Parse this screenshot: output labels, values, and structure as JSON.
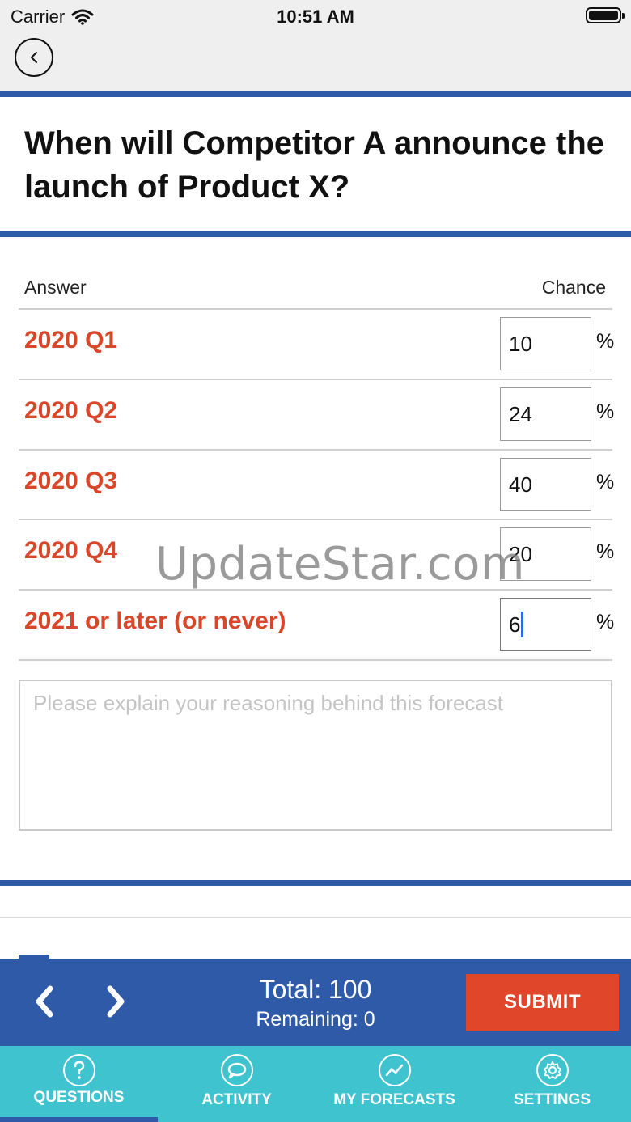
{
  "status_bar": {
    "carrier": "Carrier",
    "time": "10:51 AM"
  },
  "question": {
    "title": "When will Competitor A announce the launch of Product X?"
  },
  "table": {
    "answer_header": "Answer",
    "chance_header": "Chance",
    "rows": [
      {
        "label": "2020 Q1",
        "value": "10",
        "unit": "%"
      },
      {
        "label": "2020 Q2",
        "value": "24",
        "unit": "%"
      },
      {
        "label": "2020 Q3",
        "value": "40",
        "unit": "%"
      },
      {
        "label": "2020 Q4",
        "value": "20",
        "unit": "%"
      },
      {
        "label": "2021 or later (or never)",
        "value": "6",
        "unit": "%"
      }
    ]
  },
  "reasoning": {
    "placeholder": "Please explain your reasoning behind this forecast"
  },
  "watermark": "UpdateStar.com",
  "action_bar": {
    "total": "Total: 100",
    "remaining": "Remaining: 0",
    "submit_label": "SUBMIT"
  },
  "tabs": [
    {
      "label": "QUESTIONS",
      "icon": "question-icon",
      "active": true
    },
    {
      "label": "ACTIVITY",
      "icon": "chat-bubble-icon",
      "active": false
    },
    {
      "label": "MY FORECASTS",
      "icon": "trend-line-icon",
      "active": false
    },
    {
      "label": "SETTINGS",
      "icon": "gear-icon",
      "active": false
    }
  ],
  "colors": {
    "accent_blue": "#2f5aa8",
    "answer_red": "#d9472b",
    "submit_red": "#e0462a",
    "tabbar_teal": "#3fc3cf"
  }
}
